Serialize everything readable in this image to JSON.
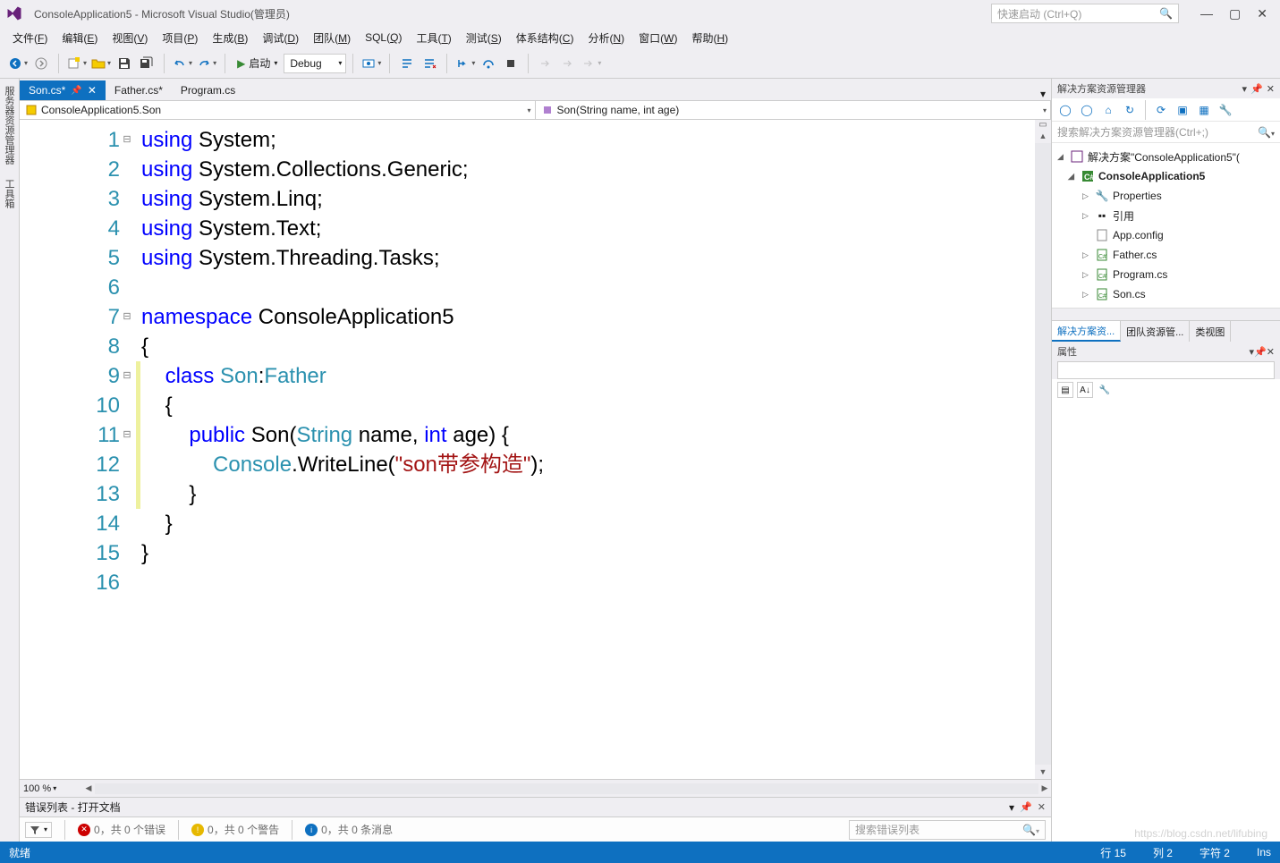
{
  "title": "ConsoleApplication5 - Microsoft Visual Studio(管理员)",
  "quick_launch_placeholder": "快速启动 (Ctrl+Q)",
  "menu": [
    "文件(F)",
    "编辑(E)",
    "视图(V)",
    "项目(P)",
    "生成(B)",
    "调试(D)",
    "团队(M)",
    "SQL(Q)",
    "工具(T)",
    "测试(S)",
    "体系结构(C)",
    "分析(N)",
    "窗口(W)",
    "帮助(H)"
  ],
  "toolbar": {
    "start_label": "启动",
    "config_label": "Debug"
  },
  "left_vtabs": [
    "服务器资源管理器",
    "工具箱"
  ],
  "doc_tabs": [
    {
      "label": "Son.cs*",
      "active": true,
      "pinned": true
    },
    {
      "label": "Father.cs*",
      "active": false,
      "pinned": false
    },
    {
      "label": "Program.cs",
      "active": false,
      "pinned": false
    }
  ],
  "nav": {
    "namespace": "ConsoleApplication5.Son",
    "member": "Son(String name, int age)"
  },
  "code": {
    "lines": [
      {
        "n": 1,
        "fold": "-",
        "seg": [
          [
            "kw",
            "using"
          ],
          [
            "punc",
            " "
          ],
          [
            "ident",
            "System"
          ],
          [
            "punc",
            ";"
          ]
        ]
      },
      {
        "n": 2,
        "seg": [
          [
            "kw",
            "using"
          ],
          [
            "punc",
            " "
          ],
          [
            "ident",
            "System.Collections.Generic"
          ],
          [
            "punc",
            ";"
          ]
        ]
      },
      {
        "n": 3,
        "seg": [
          [
            "kw",
            "using"
          ],
          [
            "punc",
            " "
          ],
          [
            "ident",
            "System.Linq"
          ],
          [
            "punc",
            ";"
          ]
        ]
      },
      {
        "n": 4,
        "seg": [
          [
            "kw",
            "using"
          ],
          [
            "punc",
            " "
          ],
          [
            "ident",
            "System.Text"
          ],
          [
            "punc",
            ";"
          ]
        ]
      },
      {
        "n": 5,
        "seg": [
          [
            "kw",
            "using"
          ],
          [
            "punc",
            " "
          ],
          [
            "ident",
            "System.Threading.Tasks"
          ],
          [
            "punc",
            ";"
          ]
        ]
      },
      {
        "n": 6,
        "seg": []
      },
      {
        "n": 7,
        "fold": "-",
        "seg": [
          [
            "kw",
            "namespace"
          ],
          [
            "punc",
            " "
          ],
          [
            "ident",
            "ConsoleApplication5"
          ]
        ]
      },
      {
        "n": 8,
        "seg": [
          [
            "punc",
            "{"
          ]
        ]
      },
      {
        "n": 9,
        "fold": "-",
        "changed": true,
        "seg": [
          [
            "punc",
            "    "
          ],
          [
            "kw",
            "class"
          ],
          [
            "punc",
            " "
          ],
          [
            "type",
            "Son"
          ],
          [
            "punc",
            ":"
          ],
          [
            "type",
            "Father"
          ]
        ]
      },
      {
        "n": 10,
        "changed": true,
        "seg": [
          [
            "punc",
            "    {"
          ]
        ]
      },
      {
        "n": 11,
        "fold": "-",
        "changed": true,
        "seg": [
          [
            "punc",
            "        "
          ],
          [
            "kw",
            "public"
          ],
          [
            "punc",
            " "
          ],
          [
            "ident",
            "Son"
          ],
          [
            "punc",
            "("
          ],
          [
            "type",
            "String"
          ],
          [
            "punc",
            " name, "
          ],
          [
            "kw",
            "int"
          ],
          [
            "punc",
            " age) {"
          ]
        ]
      },
      {
        "n": 12,
        "changed": true,
        "seg": [
          [
            "punc",
            "            "
          ],
          [
            "type",
            "Console"
          ],
          [
            "punc",
            ".WriteLine("
          ],
          [
            "str",
            "\"son带参构造\""
          ],
          [
            "punc",
            ");"
          ]
        ]
      },
      {
        "n": 13,
        "changed": true,
        "seg": [
          [
            "punc",
            "        }"
          ]
        ]
      },
      {
        "n": 14,
        "seg": [
          [
            "punc",
            "    }"
          ]
        ]
      },
      {
        "n": 15,
        "seg": [
          [
            "punc",
            "}"
          ]
        ]
      },
      {
        "n": 16,
        "seg": []
      }
    ]
  },
  "zoom": "100 %",
  "error_panel": {
    "title": "错误列表 - 打开文档",
    "errors": "0，共 0 个错误",
    "warnings": "0，共 0 个警告",
    "messages": "0，共 0 条消息",
    "search_placeholder": "搜索错误列表"
  },
  "solution_explorer": {
    "title": "解决方案资源管理器",
    "search_placeholder": "搜索解决方案资源管理器(Ctrl+;)",
    "solution_label": "解决方案\"ConsoleApplication5\"(",
    "project": "ConsoleApplication5",
    "nodes": [
      "Properties",
      "引用",
      "App.config",
      "Father.cs",
      "Program.cs",
      "Son.cs"
    ]
  },
  "right_tabs": [
    "解决方案资...",
    "团队资源管...",
    "类视图"
  ],
  "properties": {
    "title": "属性"
  },
  "status": {
    "ready": "就绪",
    "line": "行 15",
    "col": "列 2",
    "char": "字符 2",
    "ins": "Ins"
  },
  "watermark": "https://blog.csdn.net/lifubing"
}
